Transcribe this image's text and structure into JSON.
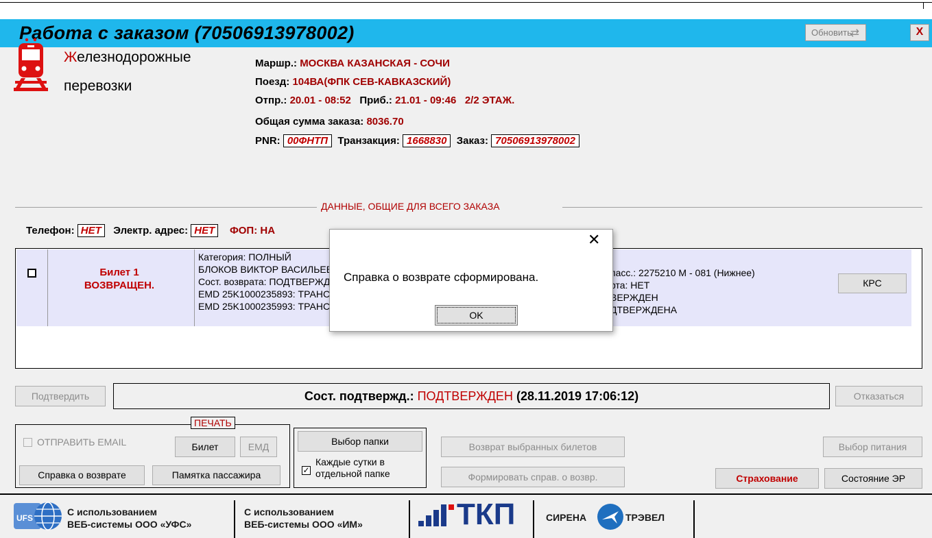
{
  "window": {
    "title": "Работа с заказом (70506913978002)",
    "refresh_label": "Обновить",
    "close_label": "X"
  },
  "company": {
    "line1_first": "Ж",
    "line1_rest": "елезнодорожные",
    "line2": "перевозки"
  },
  "order_info": {
    "route_label": "Маршр.:",
    "route_value": "МОСКВА КАЗАНСКАЯ - СОЧИ",
    "train_label": "Поезд:",
    "train_value": "104ВА(ФПК СЕВ-КАВКАЗСКИЙ)",
    "dep_label": "Отпр.:",
    "dep_value": "20.01 - 08:52",
    "arr_label": "Приб.:",
    "arr_value": "21.01 - 09:46",
    "floor_value": "2/2 ЭТАЖ.",
    "total_label": "Общая сумма заказа:",
    "total_value": "8036.70",
    "pnr_label": "PNR:",
    "pnr_value": "00ФНТП",
    "transaction_label": "Транзакция:",
    "transaction_value": "1668830",
    "order_label": "Заказ:",
    "order_value": "70506913978002"
  },
  "common_section": {
    "title": "ДАННЫЕ, ОБЩИЕ ДЛЯ ВСЕГО ЗАКАЗА",
    "phone_label": "Телефон:",
    "phone_value": "НЕТ",
    "email_label": "Электр. адрес:",
    "email_value": "НЕТ",
    "fop_label": "ФОП:",
    "fop_value": "НА"
  },
  "ticket": {
    "status_line1": "Билет 1",
    "status_line2": "ВОЗВРАЩЕН.",
    "details": [
      "Категория: ПОЛНЫЙ",
      "БЛОКОВ ВИКТОР ВАСИЛЬЕВИЧ",
      "Сост. возврата: ПОДТВЕРЖДЕН",
      "EMD 25K1000235893: ТРАНСФЕР",
      "EMD 25K1000235993: ТРАНСФЕР"
    ],
    "right_details": [
      "пасс.: 2275210  М - 081 (Нижнее)",
      "рта: НЕТ",
      "ВЕРЖДЕН",
      "ДТВЕРЖДЕНА"
    ],
    "krs_label": "КРС"
  },
  "confirm_bar": {
    "confirm_label": "Подтвердить",
    "status_label": "Сост. подтвержд.:",
    "status_value": "ПОДТВЕРЖДЕН",
    "status_time": "(28.11.2019 17:06:12)",
    "cancel_label": "Отказаться"
  },
  "print": {
    "title": "ПЕЧАТЬ",
    "send_email_label": "ОТПРАВИТЬ EMAIL",
    "ticket_label": "Билет",
    "emd_label": "ЕМД",
    "refund_cert_label": "Справка о возврате",
    "passenger_memo_label": "Памятка пассажира"
  },
  "folder": {
    "choose_label": "Выбор папки",
    "daily_label_line1": "Каждые сутки в",
    "daily_label_line2": "отдельной папке",
    "daily_checked": "✓"
  },
  "actions": {
    "return_selected_label": "Возврат выбранных билетов",
    "form_refund_label": "Формировать справ. о возвр.",
    "meal_label": "Выбор питания",
    "insurance_label": "Страхование",
    "er_state_label": "Состояние ЭР"
  },
  "footer": {
    "ufs_line1": "С использованием",
    "ufs_line2": "ВЕБ-системы ООО «УФС»",
    "im_line1": "С использованием",
    "im_line2": "ВЕБ-системы ООО «ИМ»",
    "tkp_logo": "ТКП",
    "sirena_left": "СИРЕНА",
    "sirena_right": "ТРЭВЕЛ",
    "ufs_logo": "UFS"
  },
  "dialog": {
    "message": "Справка о возврате сформирована.",
    "ok_label": "OK",
    "close_glyph": "✕"
  },
  "colors": {
    "titlebar": "#1fb7ec",
    "accent_red": "#c00000",
    "ticket_row": "#e6e6fa"
  }
}
